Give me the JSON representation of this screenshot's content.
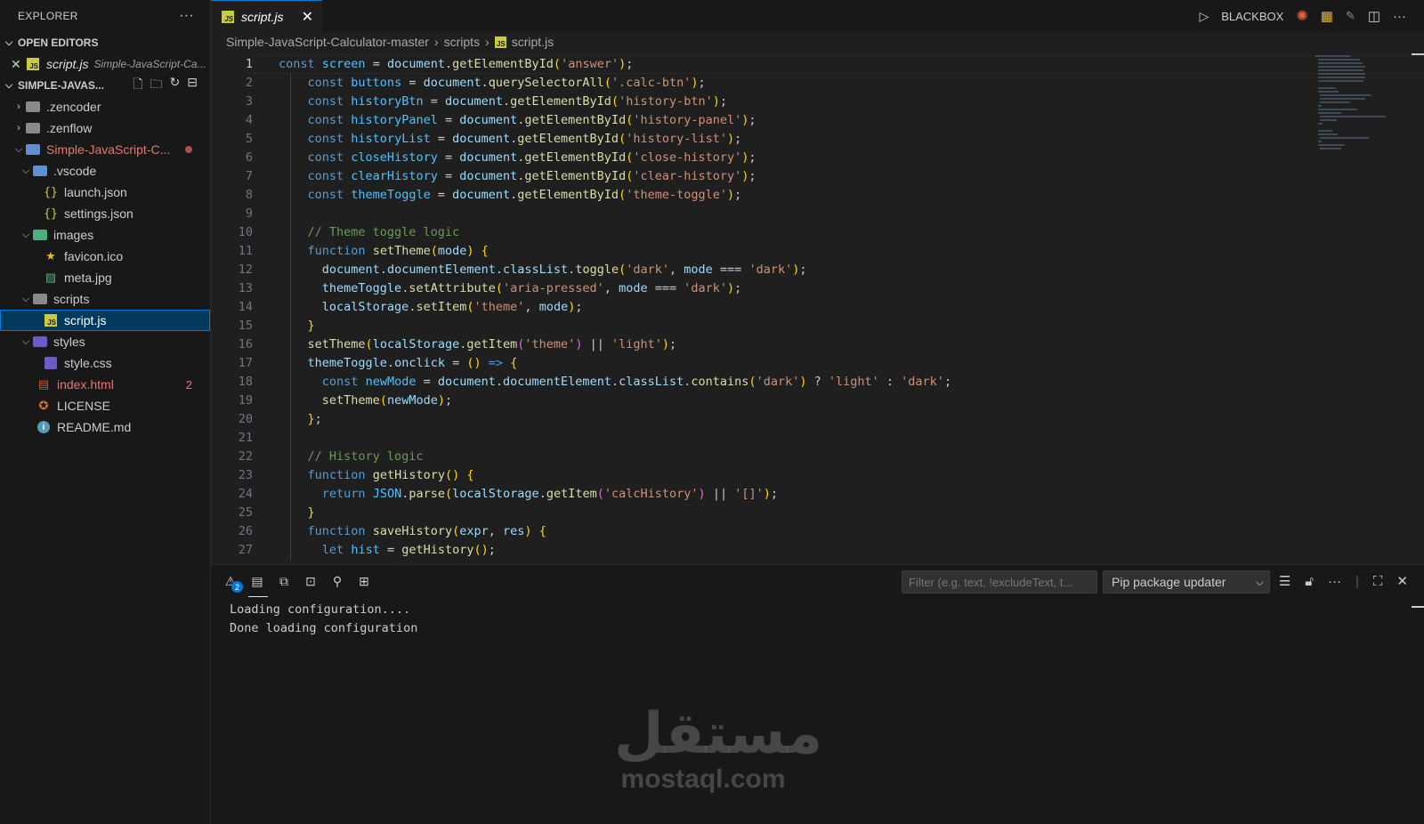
{
  "sidebar": {
    "title": "EXPLORER",
    "open_editors_label": "OPEN EDITORS",
    "open_editor": {
      "name": "script.js",
      "path": "Simple-JavaScript-Ca..."
    },
    "workspace_label": "SIMPLE-JAVAS...",
    "tree": [
      {
        "label": ".zencoder",
        "type": "folder"
      },
      {
        "label": ".zenflow",
        "type": "folder"
      },
      {
        "label": "Simple-JavaScript-C...",
        "type": "folder-open"
      },
      {
        "label": ".vscode",
        "type": "folder-open"
      },
      {
        "label": "launch.json",
        "type": "json"
      },
      {
        "label": "settings.json",
        "type": "json"
      },
      {
        "label": "images",
        "type": "folder-open"
      },
      {
        "label": "favicon.ico",
        "type": "ico"
      },
      {
        "label": "meta.jpg",
        "type": "image"
      },
      {
        "label": "scripts",
        "type": "folder-open"
      },
      {
        "label": "script.js",
        "type": "js"
      },
      {
        "label": "styles",
        "type": "folder-open"
      },
      {
        "label": "style.css",
        "type": "css"
      },
      {
        "label": "index.html",
        "type": "html",
        "badge": "2"
      },
      {
        "label": "LICENSE",
        "type": "license"
      },
      {
        "label": "README.md",
        "type": "info"
      }
    ]
  },
  "tabs": [
    {
      "label": "script.js",
      "icon": "JS"
    }
  ],
  "top_actions": {
    "extension_label": "BLACKBOX"
  },
  "breadcrumb": [
    "Simple-JavaScript-Calculator-master",
    "scripts",
    "script.js"
  ],
  "editor": {
    "line_numbers": [
      "1",
      "2",
      "3",
      "4",
      "5",
      "6",
      "7",
      "8",
      "9",
      "10",
      "11",
      "12",
      "13",
      "14",
      "15",
      "16",
      "17",
      "18",
      "19",
      "20",
      "21",
      "22",
      "23",
      "24",
      "25",
      "26",
      "27"
    ],
    "lines": [
      "const screen = document.getElementById('answer');",
      "    const buttons = document.querySelectorAll('.calc-btn');",
      "    const historyBtn = document.getElementById('history-btn');",
      "    const historyPanel = document.getElementById('history-panel');",
      "    const historyList = document.getElementById('history-list');",
      "    const closeHistory = document.getElementById('close-history');",
      "    const clearHistory = document.getElementById('clear-history');",
      "    const themeToggle = document.getElementById('theme-toggle');",
      "",
      "    // Theme toggle logic",
      "    function setTheme(mode) {",
      "      document.documentElement.classList.toggle('dark', mode === 'dark');",
      "      themeToggle.setAttribute('aria-pressed', mode === 'dark');",
      "      localStorage.setItem('theme', mode);",
      "    }",
      "    setTheme(localStorage.getItem('theme') || 'light');",
      "    themeToggle.onclick = () => {",
      "      const newMode = document.documentElement.classList.contains('dark') ? 'light' : 'dark';",
      "      setTheme(newMode);",
      "    };",
      "",
      "    // History logic",
      "    function getHistory() {",
      "      return JSON.parse(localStorage.getItem('calcHistory') || '[]');",
      "    }",
      "    function saveHistory(expr, res) {",
      "      let hist = getHistory();"
    ]
  },
  "panel": {
    "problems_count": "2",
    "filter_placeholder": "Filter (e.g. text, !excludeText, t...",
    "selected_channel": "Pip package updater",
    "output_lines": [
      "Loading configuration....",
      "Done loading configuration"
    ]
  },
  "watermark": {
    "arabic": "مستقل",
    "latin": "mostaql.com"
  },
  "colors": {
    "accent": "#0078d4",
    "editor_bg": "#1f1f1f",
    "sidebar_bg": "#181818",
    "error": "#e37874"
  }
}
